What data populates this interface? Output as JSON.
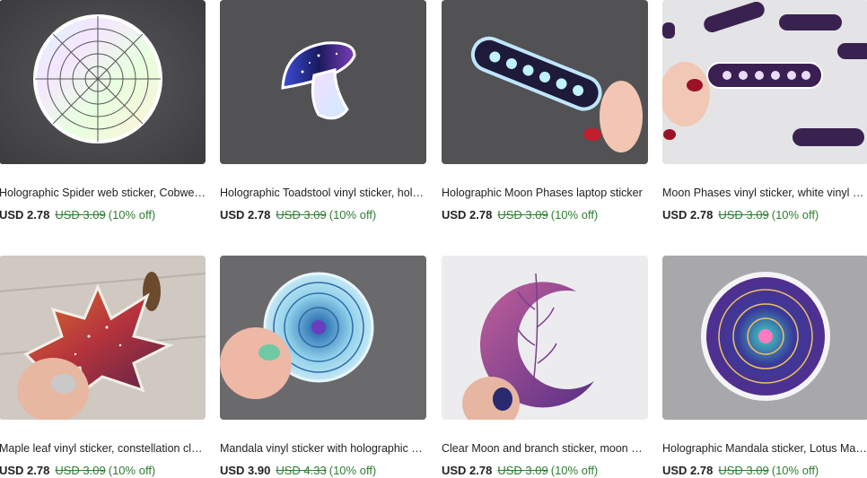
{
  "listings": [
    {
      "title": "Holographic Spider web sticker, Cobweb sticker",
      "price": "USD 2.78",
      "original_price": "USD 3.09",
      "discount": "(10% off)",
      "image": "spider-web-sticker"
    },
    {
      "title": "Holographic Toadstool vinyl sticker, holographic",
      "price": "USD 2.78",
      "original_price": "USD 3.09",
      "discount": "(10% off)",
      "image": "toadstool-sticker"
    },
    {
      "title": "Holographic Moon Phases laptop sticker",
      "price": "USD 2.78",
      "original_price": "USD 3.09",
      "discount": "(10% off)",
      "image": "moon-phases-holo-sticker"
    },
    {
      "title": "Moon Phases vinyl sticker, white vinyl sticker",
      "price": "USD 2.78",
      "original_price": "USD 3.09",
      "discount": "(10% off)",
      "image": "moon-phases-vinyl-sticker"
    },
    {
      "title": "Maple leaf vinyl sticker, constellation clear",
      "price": "USD 2.78",
      "original_price": "USD 3.09",
      "discount": "(10% off)",
      "image": "maple-leaf-sticker"
    },
    {
      "title": "Mandala vinyl sticker with holographic glitter",
      "price": "USD 3.90",
      "original_price": "USD 4.33",
      "discount": "(10% off)",
      "image": "mandala-glitter-sticker"
    },
    {
      "title": "Clear Moon and branch sticker, moon goddess",
      "price": "USD 2.78",
      "original_price": "USD 3.09",
      "discount": "(10% off)",
      "image": "moon-branch-sticker"
    },
    {
      "title": "Holographic Mandala sticker, Lotus Mandala",
      "price": "USD 2.78",
      "original_price": "USD 3.09",
      "discount": "(10% off)",
      "image": "lotus-mandala-sticker"
    }
  ]
}
